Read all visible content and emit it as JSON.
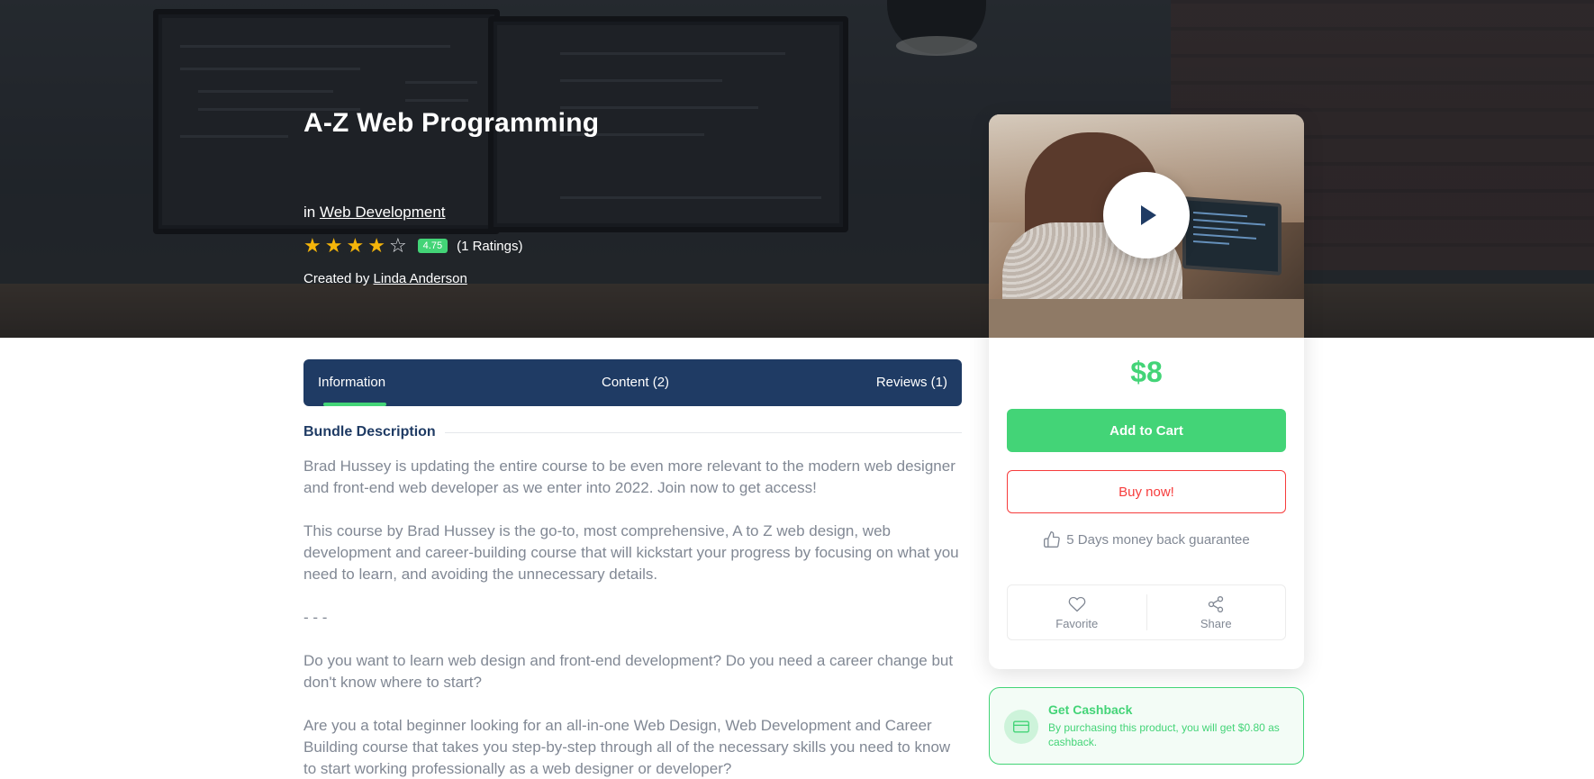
{
  "course": {
    "title": "A-Z Web Programming",
    "in_prefix": "in",
    "category": "Web Development",
    "rating_value": "4.75",
    "rating_stars": 4,
    "rating_max": 5,
    "ratings_count": "(1 Ratings)",
    "created_prefix": "Created by",
    "instructor": "Linda Anderson"
  },
  "tabs": {
    "information": "Information",
    "content": "Content (2)",
    "reviews": "Reviews (1)",
    "active": "information"
  },
  "description": {
    "heading": "Bundle Description",
    "paragraphs": [
      "Brad Hussey is updating the entire course to be even more relevant to the modern web designer and front-end web developer as we enter into 2022. Join now to get access!",
      "This course by Brad Hussey is the go-to, most comprehensive, A to Z web design, web development and career-building course that will kickstart your progress by focusing on what you need to learn, and avoiding the unnecessary details.",
      "- - -",
      "Do you want to learn web design and front-end development? Do you need a career change but don't know where to start?",
      "Are you a total beginner looking for an all-in-one Web Design, Web Development and Career Building course that takes you step-by-step through all of the necessary skills you need to know to start working professionally as a web designer or developer?"
    ]
  },
  "sidebar": {
    "price": "$8",
    "add_to_cart": "Add to Cart",
    "buy_now": "Buy now!",
    "guarantee": "5 Days money back guarantee",
    "favorite": "Favorite",
    "share": "Share"
  },
  "cashback": {
    "title": "Get Cashback",
    "text": "By purchasing this product, you will get $0.80 as cashback."
  },
  "colors": {
    "primary": "#1f3b64",
    "accent": "#43d477",
    "danger": "#f63c3c",
    "star": "#f5b50a",
    "muted_text": "#818894"
  },
  "icons": {
    "play": "play-icon",
    "guarantee": "thumbs-up-icon",
    "favorite": "heart-icon",
    "share": "share-icon",
    "cashback": "credit-card-icon"
  }
}
